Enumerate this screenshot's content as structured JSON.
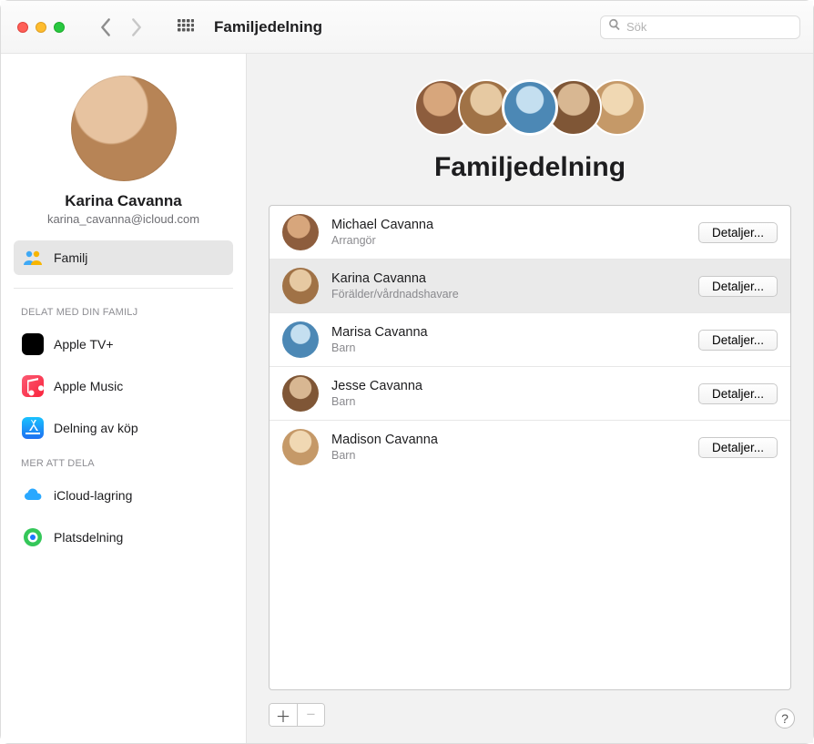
{
  "window": {
    "title": "Familjedelning"
  },
  "search": {
    "placeholder": "Sök"
  },
  "profile": {
    "name": "Karina Cavanna",
    "email": "karina_cavanna@icloud.com"
  },
  "sidebar": {
    "family_label": "Familj",
    "section_shared": "Delat med din familj",
    "section_more": "Mer att dela",
    "items_shared": [
      {
        "label": "Apple TV+"
      },
      {
        "label": "Apple Music"
      },
      {
        "label": "Delning av köp"
      }
    ],
    "items_more": [
      {
        "label": "iCloud-lagring"
      },
      {
        "label": "Platsdelning"
      }
    ]
  },
  "main": {
    "heading": "Familjedelning",
    "details_label": "Detaljer...",
    "members": [
      {
        "name": "Michael Cavanna",
        "role": "Arrangör",
        "selected": false
      },
      {
        "name": "Karina Cavanna",
        "role": "Förälder/vårdnadshavare",
        "selected": true
      },
      {
        "name": "Marisa Cavanna",
        "role": "Barn",
        "selected": false
      },
      {
        "name": "Jesse Cavanna",
        "role": "Barn",
        "selected": false
      },
      {
        "name": "Madison Cavanna",
        "role": "Barn",
        "selected": false
      }
    ]
  }
}
